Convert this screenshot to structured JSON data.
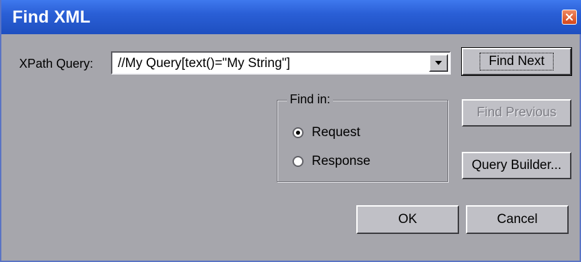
{
  "window": {
    "title": "Find XML",
    "accent": "#2a5fd6",
    "close_icon": "close-icon"
  },
  "query": {
    "label": "XPath Query:",
    "value": "//My Query[text()=\"My String\"]",
    "dropdown_icon": "chevron-down-icon"
  },
  "buttons": {
    "find_next": "Find Next",
    "find_previous": "Find Previous",
    "query_builder": "Query Builder...",
    "ok": "OK",
    "cancel": "Cancel"
  },
  "find_in": {
    "label": "Find in:",
    "options": [
      {
        "label": "Request",
        "selected": true
      },
      {
        "label": "Response",
        "selected": false
      }
    ]
  }
}
